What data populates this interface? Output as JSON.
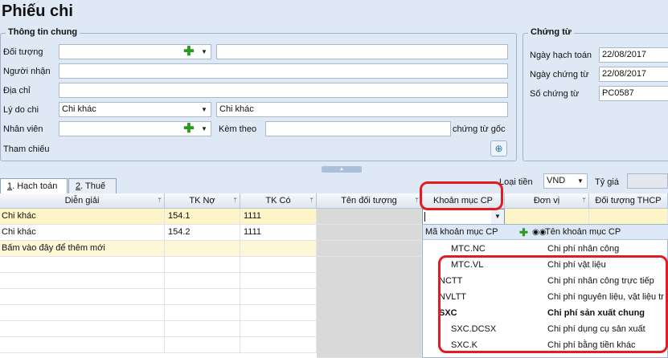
{
  "title": "Phiếu chi",
  "general_info": {
    "group_title": "Thông tin chung",
    "doi_tuong_label": "Đối tượng",
    "nguoi_nhan_label": "Người nhận",
    "dia_chi_label": "Địa chỉ",
    "ly_do_chi_label": "Lý do chi",
    "ly_do_chi_value": "Chi khác",
    "ly_do_chi_text": "Chi khác",
    "nhan_vien_label": "Nhân viên",
    "kem_theo_label": "Kèm theo",
    "chung_tu_goc_label": "chứng từ gốc",
    "tham_chieu_label": "Tham chiếu"
  },
  "voucher": {
    "group_title": "Chứng từ",
    "ngay_hach_toan_label": "Ngày hạch toán",
    "ngay_hach_toan_value": "22/08/2017",
    "ngay_chung_tu_label": "Ngày chứng từ",
    "ngay_chung_tu_value": "22/08/2017",
    "so_chung_tu_label": "Số chứng từ",
    "so_chung_tu_value": "PC0587"
  },
  "tabs": [
    {
      "key": "1",
      "label": ". Hạch toán"
    },
    {
      "key": "2",
      "label": ". Thuế"
    }
  ],
  "currency": {
    "label": "Loại tiền",
    "value": "VND",
    "rate_label": "Tỷ giá"
  },
  "grid": {
    "columns": [
      "Diễn giải",
      "TK Nợ",
      "TK Có",
      "Tên đối tượng",
      "Khoản mục CP",
      "Đơn vị",
      "Đối tượng THCP"
    ],
    "rows": [
      {
        "dien_giai": "Chi khác",
        "tk_no": "154.1",
        "tk_co": "1111"
      },
      {
        "dien_giai": "Chi khác",
        "tk_no": "154.2",
        "tk_co": "1111"
      }
    ],
    "add_new_hint": "Bấm vào đây để thêm mới"
  },
  "dropdown": {
    "col_code": "Mã khoản mục CP",
    "col_name": "Tên khoản mục CP",
    "items": [
      {
        "code": "MTC.NC",
        "name": "Chi phí nhân công",
        "bold": false
      },
      {
        "code": "MTC.VL",
        "name": "Chi phí vật liệu",
        "bold": false
      },
      {
        "code": "NCTT",
        "name": "Chi phí nhân công trực tiếp",
        "bold": false
      },
      {
        "code": "NVLTT",
        "name": "Chi phí nguyên liệu, vật liệu tr",
        "bold": false
      },
      {
        "code": "SXC",
        "name": "Chi phí sản xuất chung",
        "bold": true
      },
      {
        "code": "SXC.DCSX",
        "name": "Chi phí dụng cụ sản xuất",
        "bold": false
      },
      {
        "code": "SXC.K",
        "name": "Chi phí bằng tiền khác",
        "bold": false
      }
    ]
  },
  "colors": {
    "highlight_row": "#fdf4c8",
    "add_row": "#fdf7d7",
    "annotation": "#e31b23",
    "plus": "#2a9a1c"
  }
}
